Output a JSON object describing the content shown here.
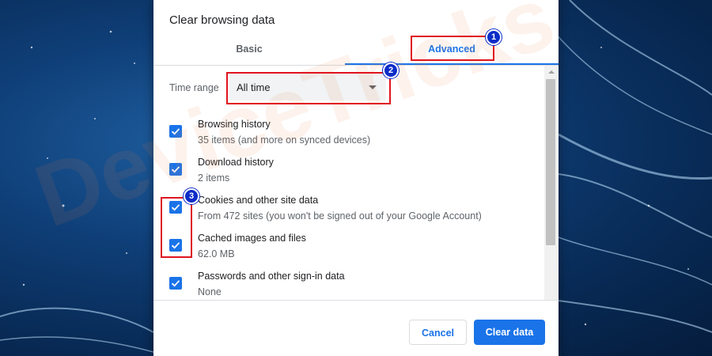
{
  "dialog": {
    "title": "Clear browsing data",
    "tabs": [
      {
        "label": "Basic",
        "selected": false
      },
      {
        "label": "Advanced",
        "selected": true
      }
    ],
    "time_range": {
      "label": "Time range",
      "value": "All time"
    },
    "items": [
      {
        "label": "Browsing history",
        "detail": "35 items (and more on synced devices)",
        "checked": true
      },
      {
        "label": "Download history",
        "detail": "2 items",
        "checked": true
      },
      {
        "label": "Cookies and other site data",
        "detail": "From 472 sites (you won't be signed out of your Google Account)",
        "checked": true
      },
      {
        "label": "Cached images and files",
        "detail": "62.0 MB",
        "checked": true
      },
      {
        "label": "Passwords and other sign-in data",
        "detail": "None",
        "checked": true
      }
    ],
    "buttons": {
      "cancel": "Cancel",
      "clear": "Clear data"
    }
  },
  "annotations": {
    "step1": "1",
    "step2": "2",
    "step3": "3"
  },
  "watermark": "DeviceTricks",
  "colors": {
    "accent": "#1a73e8",
    "highlight": "#e0141e",
    "badge": "#0b2cc8"
  }
}
